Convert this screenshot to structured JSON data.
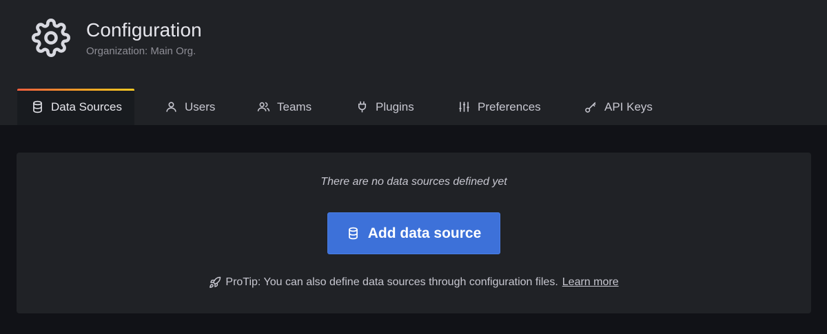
{
  "header": {
    "title": "Configuration",
    "subtitle": "Organization: Main Org.",
    "icon": "gear-icon"
  },
  "tabs": [
    {
      "label": "Data Sources",
      "icon": "database-icon",
      "active": true
    },
    {
      "label": "Users",
      "icon": "user-icon",
      "active": false
    },
    {
      "label": "Teams",
      "icon": "users-icon",
      "active": false
    },
    {
      "label": "Plugins",
      "icon": "plug-icon",
      "active": false
    },
    {
      "label": "Preferences",
      "icon": "sliders-icon",
      "active": false
    },
    {
      "label": "API Keys",
      "icon": "key-icon",
      "active": false
    }
  ],
  "empty_state": {
    "message": "There are no data sources defined yet",
    "button_label": "Add data source",
    "button_icon": "database-icon",
    "protip_icon": "rocket-icon",
    "protip_text": "ProTip: You can also define data sources through configuration files.",
    "protip_link": "Learn more"
  },
  "colors": {
    "background": "#111217",
    "header_bg": "#202226",
    "primary_button": "#3d71d9",
    "active_tab_accent": "#f5a524"
  }
}
